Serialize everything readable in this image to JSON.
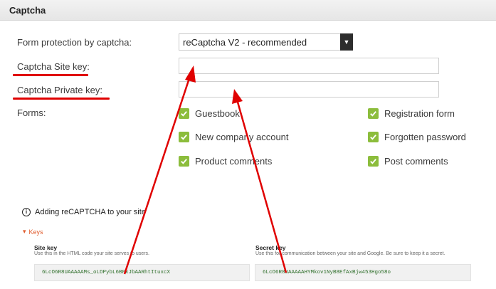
{
  "header": {
    "title": "Captcha"
  },
  "form": {
    "protection_label": "Form protection by captcha:",
    "protection_value": "reCaptcha V2 - recommended",
    "site_key_label": "Captcha Site key:",
    "private_key_label": "Captcha Private key:",
    "forms_label": "Forms:",
    "checkboxes": [
      {
        "label": "Guestbook",
        "checked": true
      },
      {
        "label": "New company account",
        "checked": true
      },
      {
        "label": "Product comments",
        "checked": true
      },
      {
        "label": "Registration form",
        "checked": true
      },
      {
        "label": "Forgotten password",
        "checked": true
      },
      {
        "label": "Post comments",
        "checked": true
      }
    ]
  },
  "recaptcha": {
    "info_text": "Adding reCAPTCHA to your site",
    "keys_toggle": "Keys",
    "site_key": {
      "title": "Site key",
      "desc": "Use this in the HTML code your site serves to users.",
      "value": "6LcO6R8UAAAAAMs_oLDPybL6BFxJbAARhtItuxcX"
    },
    "secret_key": {
      "title": "Secret key",
      "desc": "Use this for communication between your site and Google. Be sure to keep it a secret.",
      "value": "6LcO6R8UAAAAAHYMkov1NyB8EfAxBjw453Hgo58o"
    }
  },
  "colors": {
    "accent": "#8cbd3c",
    "annotation": "#e00000",
    "keys_toggle": "#e05a2b"
  }
}
